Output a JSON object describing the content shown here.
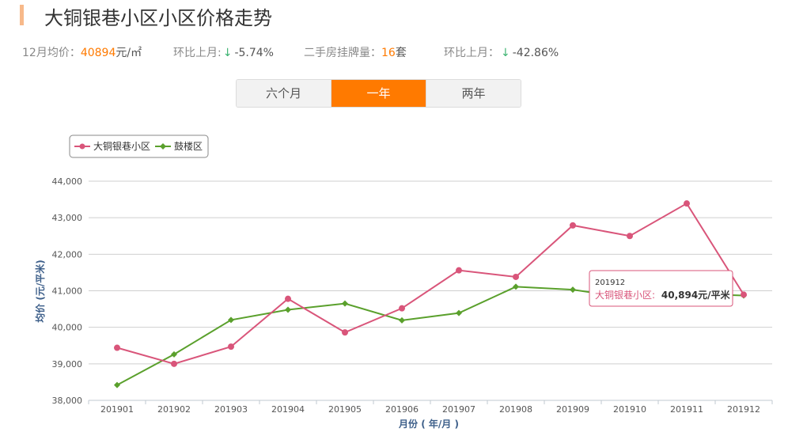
{
  "page_title": "大铜银巷小区小区价格走势",
  "stats": {
    "avg_label": "12月均价：",
    "avg_value": "40894",
    "avg_unit": "元/㎡",
    "mom1_label": "环比上月:",
    "mom1_arrow": "↓",
    "mom1_value": "-5.74%",
    "listing_label": "二手房挂牌量：",
    "listing_value": "16",
    "listing_unit": "套",
    "mom2_label": "环比上月：",
    "mom2_arrow": "↓",
    "mom2_value": "-42.86%"
  },
  "range_tabs": [
    {
      "label": "六个月",
      "active": false
    },
    {
      "label": "一年",
      "active": true
    },
    {
      "label": "两年",
      "active": false
    }
  ],
  "colors": {
    "accent": "#ff7a00",
    "series1": "#d9557a",
    "series2": "#5aa02c",
    "down": "#3cb371"
  },
  "chart_data": {
    "type": "line",
    "categories": [
      "201901",
      "201902",
      "201903",
      "201904",
      "201905",
      "201906",
      "201907",
      "201908",
      "201909",
      "201910",
      "201911",
      "201912"
    ],
    "series": [
      {
        "name": "大铜银巷小区",
        "color": "#d9557a",
        "marker": "circle",
        "values": [
          39440,
          39000,
          39470,
          40780,
          39860,
          40520,
          41560,
          41380,
          42790,
          42500,
          43390,
          40894
        ]
      },
      {
        "name": "鼓楼区",
        "color": "#5aa02c",
        "marker": "diamond",
        "values": [
          38420,
          39260,
          40200,
          40480,
          40650,
          40190,
          40390,
          41110,
          41030,
          40800,
          40920,
          40870
        ]
      }
    ],
    "ylim": [
      38000,
      44000
    ],
    "yticks": [
      38000,
      39000,
      40000,
      41000,
      42000,
      43000,
      44000
    ],
    "ytick_labels": [
      "38,000",
      "39,000",
      "40,000",
      "41,000",
      "42,000",
      "43,000",
      "44,000"
    ],
    "ylabel": "均价 (元/平米)",
    "xlabel": "月份 ( 年/月 )",
    "grid": true,
    "legend": "top-left",
    "tooltip": {
      "title": "201912",
      "series_label": "大铜银巷小区:",
      "value": "40,894元/平米"
    }
  }
}
